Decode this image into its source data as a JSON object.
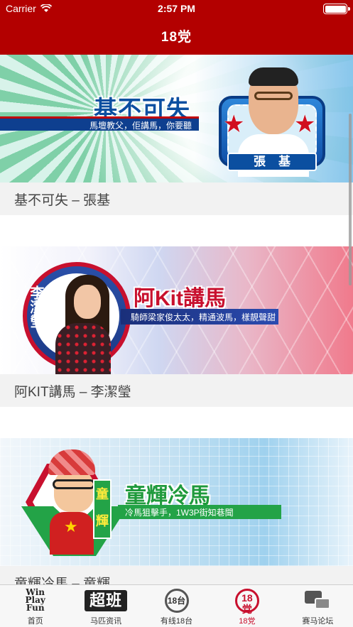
{
  "status_bar": {
    "carrier": "Carrier",
    "time": "2:57 PM"
  },
  "navbar": {
    "title": "18党"
  },
  "feed": [
    {
      "caption": "基不可失 – 張基",
      "banner": {
        "title": "基不可失",
        "tagline": "馬壇教父，佢講馬，你要聽",
        "name": "張基"
      }
    },
    {
      "caption": "阿KIT講馬 – 李潔瑩",
      "banner": {
        "title": "阿Kit講馬",
        "tagline": "騎師梁家俊太太，精通波馬，樣靚聲甜",
        "name": "李潔瑩"
      }
    },
    {
      "caption": "童輝冷馬 – 童輝",
      "banner": {
        "title": "童輝冷馬",
        "tagline": "冷馬狙擊手，1W3P街知巷聞",
        "name": "童輝"
      }
    }
  ],
  "tabbar": {
    "tabs": [
      {
        "label": "首页",
        "icon": "win-play-fun-icon",
        "icon_text": "Win Play Fun"
      },
      {
        "label": "马匹资讯",
        "icon": "super-class-icon",
        "icon_text": "超班"
      },
      {
        "label": "有线18台",
        "icon": "tv-18-icon",
        "icon_text": "18台"
      },
      {
        "label": "18党",
        "icon": "party-18-icon",
        "icon_text": "18党",
        "active": true
      },
      {
        "label": "赛马论坛",
        "icon": "forum-icon"
      }
    ]
  },
  "colors": {
    "brand": "#b30000",
    "active_tab": "#c8102e",
    "caption_bg": "#f2f2f2"
  }
}
